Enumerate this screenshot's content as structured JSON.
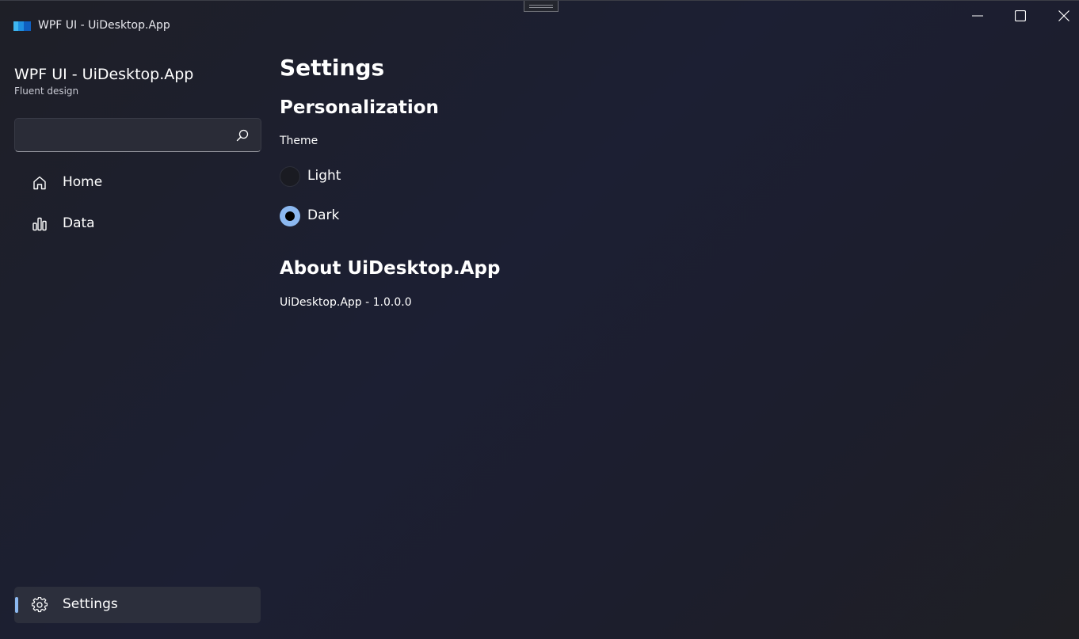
{
  "window": {
    "title": "WPF UI - UiDesktop.App",
    "app_icon": "app-logo-icon",
    "controls": {
      "minimize_icon": "minimize-icon",
      "maximize_icon": "maximize-icon",
      "close_icon": "close-icon"
    }
  },
  "sidebar": {
    "title": "WPF UI - UiDesktop.App",
    "subtitle": "Fluent design",
    "search": {
      "value": "",
      "placeholder": "",
      "icon": "search-icon"
    },
    "items": [
      {
        "label": "Home",
        "icon": "home-icon"
      },
      {
        "label": "Data",
        "icon": "chart-icon"
      }
    ],
    "footer_items": [
      {
        "label": "Settings",
        "icon": "gear-icon",
        "active": true
      }
    ]
  },
  "main": {
    "page_title": "Settings",
    "personalization": {
      "heading": "Personalization",
      "theme_label": "Theme",
      "options": [
        {
          "label": "Light",
          "selected": false
        },
        {
          "label": "Dark",
          "selected": true
        }
      ]
    },
    "about": {
      "heading": "About UiDesktop.App",
      "version_text": "UiDesktop.App - 1.0.0.0"
    }
  },
  "colors": {
    "accent": "#8cb8f0",
    "background": "#1c1f2e",
    "text": "#ffffff"
  }
}
